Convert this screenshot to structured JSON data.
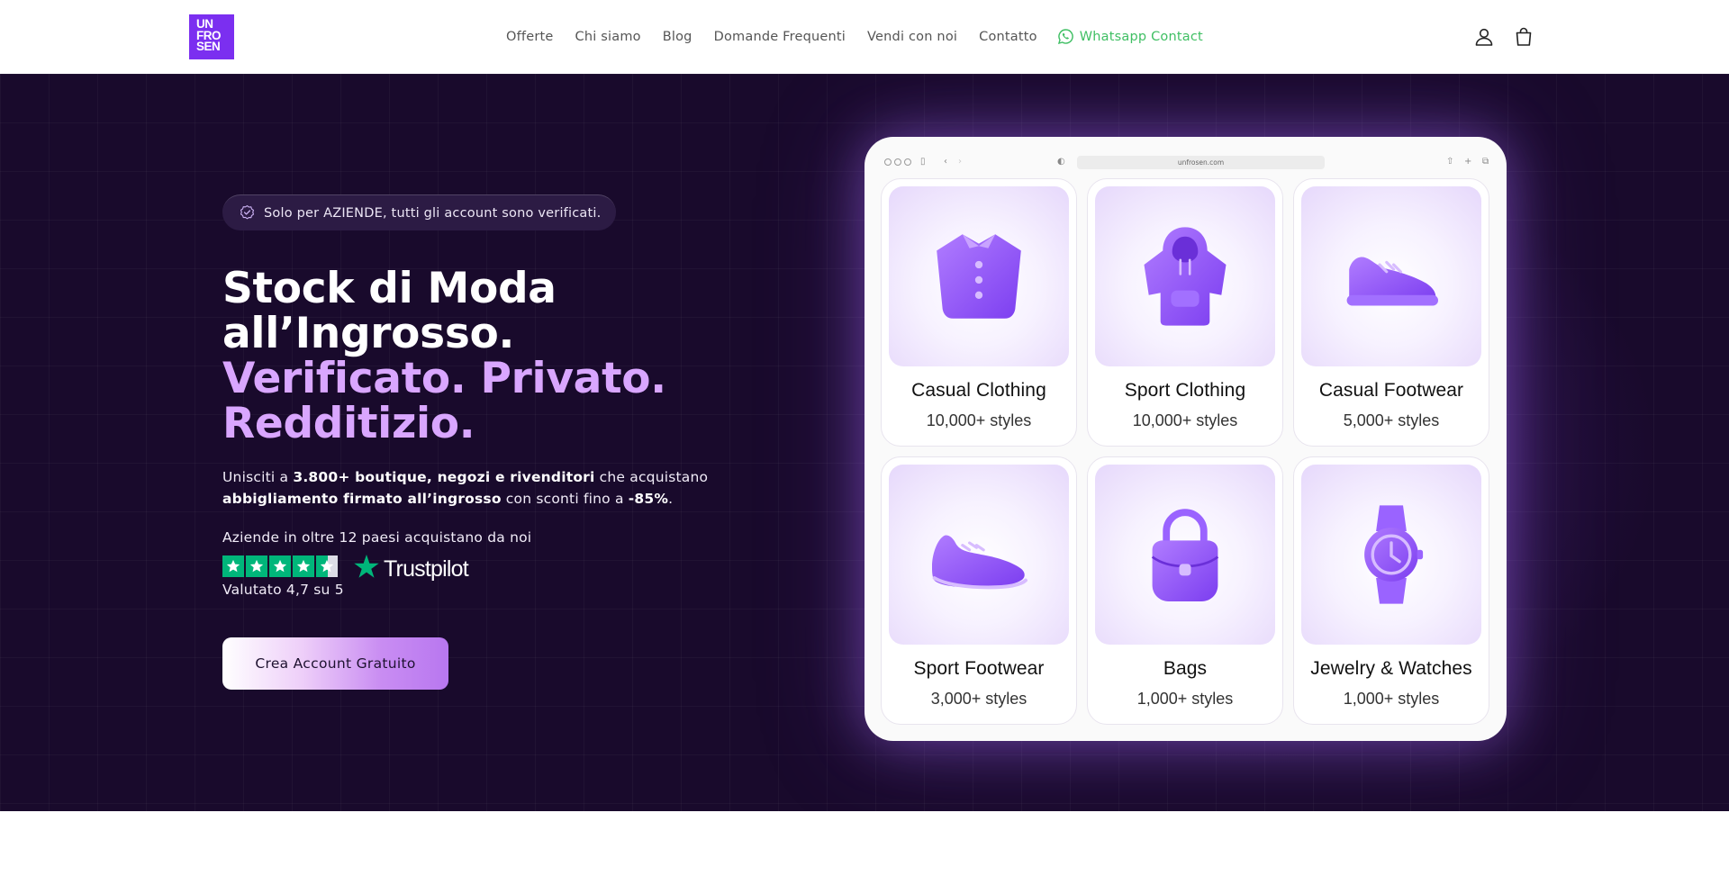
{
  "header": {
    "logo_lines": [
      "UN",
      "FRO",
      "SEN"
    ],
    "nav": [
      {
        "label": "Offerte"
      },
      {
        "label": "Chi siamo"
      },
      {
        "label": "Blog"
      },
      {
        "label": "Domande Frequenti"
      },
      {
        "label": "Vendi con noi"
      },
      {
        "label": "Contatto"
      }
    ],
    "whatsapp_label": "Whatsapp Contact",
    "icons": [
      "account-icon",
      "cart-icon"
    ]
  },
  "hero": {
    "badge": "Solo per AZIENDE, tutti gli account sono verificati.",
    "title_line1": "Stock di Moda",
    "title_line2": "all’Ingrosso.",
    "title_line3": "Verificato. Privato.",
    "title_line4": "Redditizio.",
    "sub_1": "Unisciti a ",
    "sub_bold_1": "3.800+ boutique, negozi e rivenditori",
    "sub_2": " che acquistano ",
    "sub_bold_2": "abbigliamento firmato all’ingrosso",
    "sub_3": " con sconti fino a ",
    "sub_bold_3": "-85%",
    "sub_4": ".",
    "countries": "Aziende in oltre 12 paesi acquistano da noi",
    "trustpilot_label": "Trustpilot",
    "stars_value": 4.7,
    "stars_max": 5,
    "rating": "Valutato 4,7 su 5",
    "cta": "Crea Account Gratuito"
  },
  "mockup": {
    "url": "unfrosen.com",
    "categories": [
      {
        "title": "Casual Clothing",
        "sub": "10,000+ styles",
        "icon": "shirt-icon"
      },
      {
        "title": "Sport Clothing",
        "sub": "10,000+ styles",
        "icon": "hoodie-icon"
      },
      {
        "title": "Casual Footwear",
        "sub": "5,000+ styles",
        "icon": "casual-shoe-icon"
      },
      {
        "title": "Sport Footwear",
        "sub": "3,000+ styles",
        "icon": "sneaker-icon"
      },
      {
        "title": "Bags",
        "sub": "1,000+ styles",
        "icon": "bag-icon"
      },
      {
        "title": "Jewelry & Watches",
        "sub": "1,000+ styles",
        "icon": "watch-icon"
      }
    ]
  },
  "colors": {
    "brand": "#7b2ff0",
    "hero_bg": "#190a2c",
    "accent_purple": "#d9a6ff",
    "trustpilot_green": "#00b67a",
    "whatsapp_green": "#3fbf63"
  }
}
